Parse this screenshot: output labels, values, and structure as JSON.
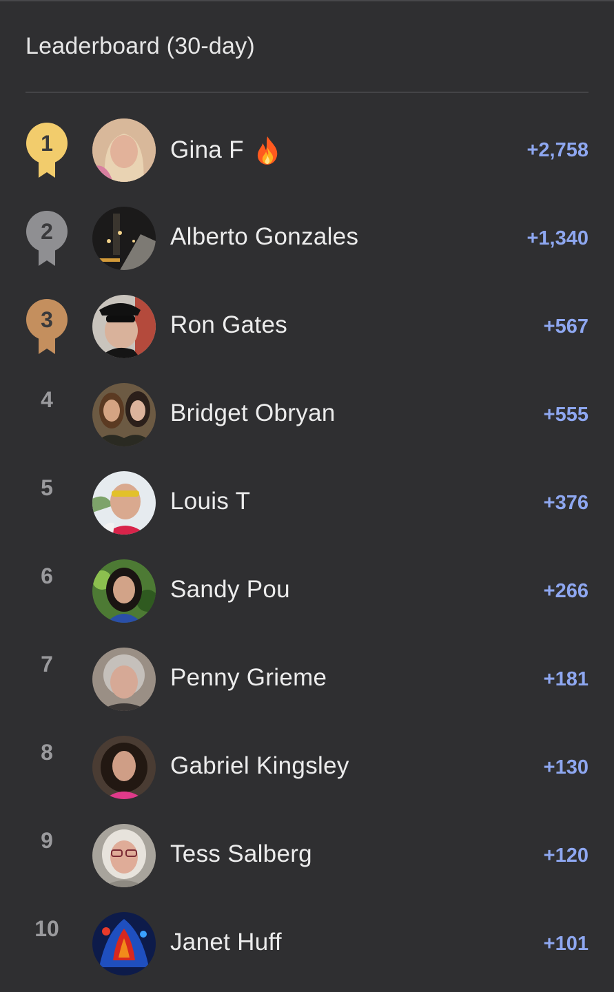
{
  "header": {
    "title": "Leaderboard (30-day)"
  },
  "entries": [
    {
      "rank": "1",
      "name": "Gina F",
      "score": "+2,758",
      "badge": "gold",
      "streak": true
    },
    {
      "rank": "2",
      "name": "Alberto Gonzales",
      "score": "+1,340",
      "badge": "silver"
    },
    {
      "rank": "3",
      "name": "Ron Gates",
      "score": "+567",
      "badge": "bronze"
    },
    {
      "rank": "4",
      "name": "Bridget Obryan",
      "score": "+555"
    },
    {
      "rank": "5",
      "name": "Louis T",
      "score": "+376"
    },
    {
      "rank": "6",
      "name": "Sandy Pou",
      "score": "+266"
    },
    {
      "rank": "7",
      "name": "Penny Grieme",
      "score": "+181"
    },
    {
      "rank": "8",
      "name": "Gabriel Kingsley",
      "score": "+130"
    },
    {
      "rank": "9",
      "name": "Tess Salberg",
      "score": "+120"
    },
    {
      "rank": "10",
      "name": "Janet Huff",
      "score": "+101"
    }
  ],
  "colors": {
    "background": "#2f2f31",
    "score": "#8ea7f0",
    "gold": "#f2cc6c",
    "silver": "#8f8f92",
    "bronze": "#c48f5e"
  },
  "icons": {
    "streak": "fire-icon",
    "rank_top3": "medal-ribbon-icon"
  }
}
